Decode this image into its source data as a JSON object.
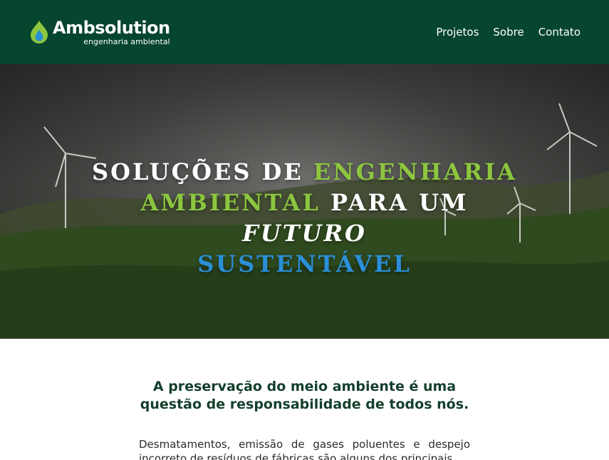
{
  "header": {
    "logo_name": "Ambsolution",
    "logo_tagline": "engenharia ambiental",
    "nav": [
      {
        "label": "Projetos"
      },
      {
        "label": "Sobre"
      },
      {
        "label": "Contato"
      }
    ],
    "colors": {
      "background": "#06452e",
      "logo_drop_green": "#8cc63f",
      "logo_drop_blue": "#2a8fd8"
    }
  },
  "hero": {
    "title_part1": "SOLUÇÕES DE ",
    "title_green": "ENGENHARIA AMBIENTAL",
    "title_part2": " PARA UM ",
    "title_italic": "FUTURO",
    "title_blue": "SUSTENTÁVEL",
    "image_description": "wind-turbines-on-green-hills",
    "colors": {
      "green": "#8cc63f",
      "blue": "#2a8fd8"
    }
  },
  "about": {
    "heading": "A preservação do meio ambiente é uma questão de responsabilidade de todos nós.",
    "paragraph": "Desmatamentos, emissão de gases poluentes e despejo incorreto de resíduos de fábricas são alguns dos principais"
  }
}
